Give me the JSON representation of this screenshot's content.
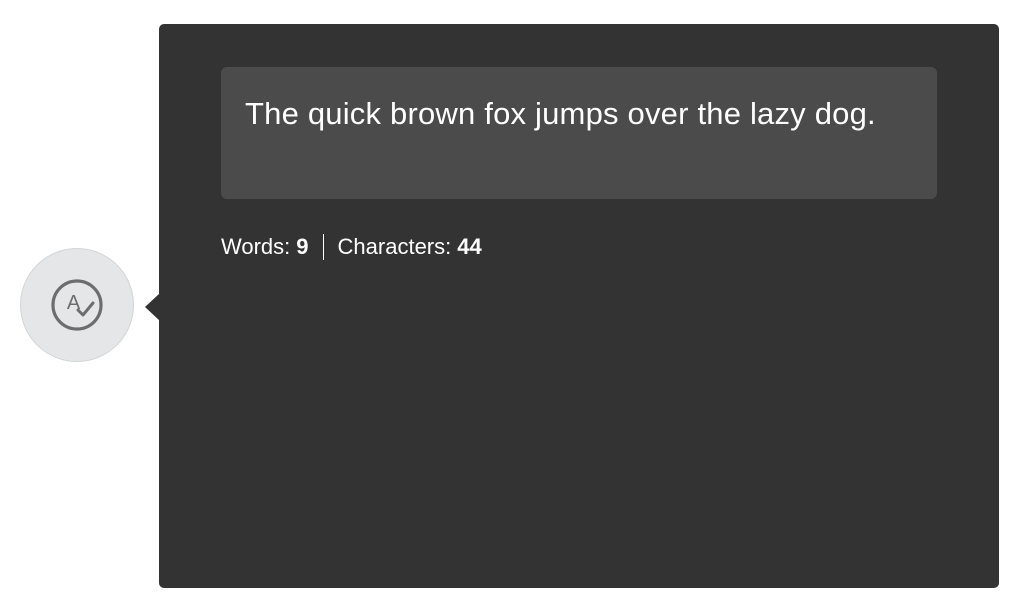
{
  "trigger": {
    "icon": "spellcheck-icon"
  },
  "popover": {
    "text": "The quick brown fox jumps over the lazy dog.",
    "stats": {
      "words_label": "Words:",
      "words_value": "9",
      "characters_label": "Characters:",
      "characters_value": "44"
    }
  },
  "colors": {
    "panel_background": "#333333",
    "text_box_background": "#4b4b4b",
    "trigger_background": "#e4e6e7",
    "icon_color": "#6b6e70",
    "text": "#ffffff"
  }
}
